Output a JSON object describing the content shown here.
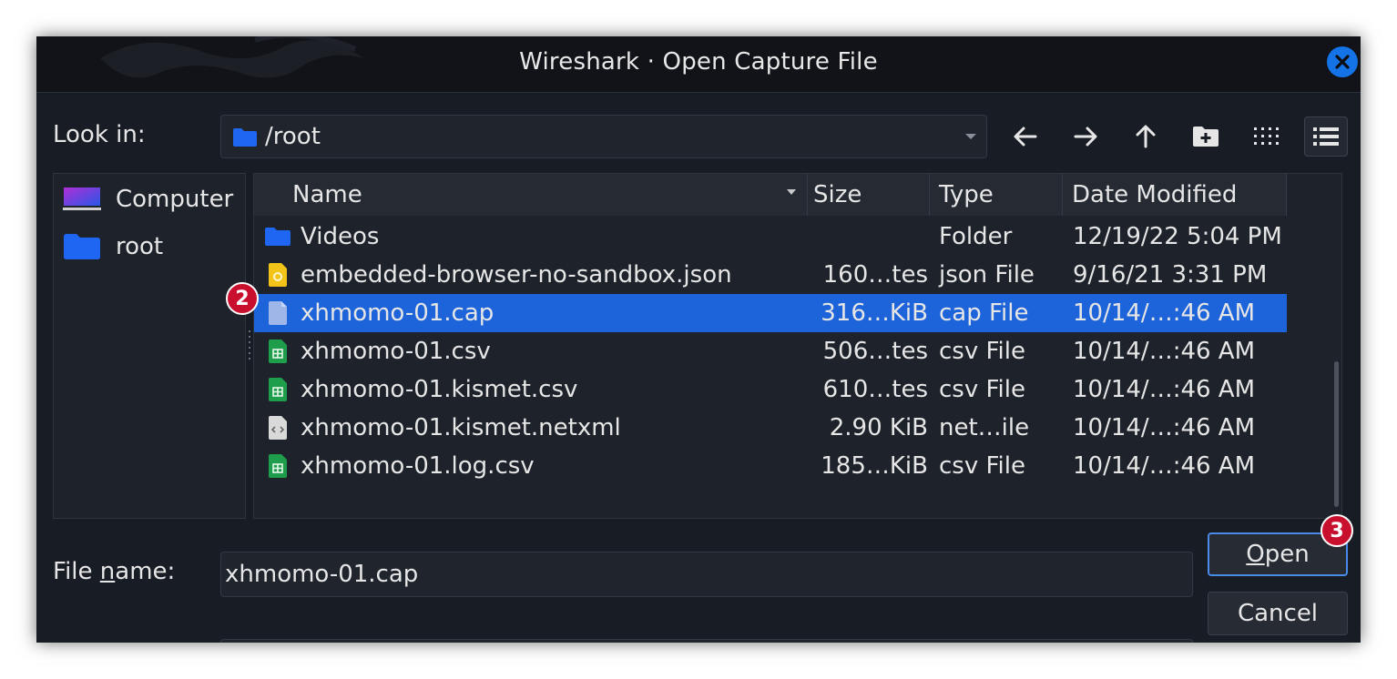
{
  "window": {
    "title": "Wireshark · Open Capture File",
    "accent_color": "#1473e6"
  },
  "toolbar": {
    "look_in_label": "Look in:",
    "path": "/root",
    "buttons": [
      "back-arrow-icon",
      "forward-arrow-icon",
      "up-arrow-icon",
      "new-folder-icon",
      "icon-view-icon",
      "detail-view-icon"
    ]
  },
  "sidebar": {
    "items": [
      {
        "label": "Computer",
        "icon": "computer-icon"
      },
      {
        "label": "root",
        "icon": "folder-icon"
      }
    ]
  },
  "file_list": {
    "columns": [
      "Name",
      "Size",
      "Type",
      "Date Modified"
    ],
    "selected_color": "#1d63d9",
    "rows": [
      {
        "name": "Videos",
        "size": "",
        "type": "Folder",
        "date": "12/19/22 5:04 PM",
        "icon": "folder-icon"
      },
      {
        "name": "embedded-browser-no-sandbox.json",
        "size": "160…tes",
        "type": "json File",
        "date": "9/16/21 3:31 PM",
        "icon": "json-file-icon"
      },
      {
        "name": "xhmomo-01.cap",
        "size": "316…KiB",
        "type": "cap File",
        "date": "10/14/…:46 AM",
        "icon": "file-icon",
        "selected": true
      },
      {
        "name": "xhmomo-01.csv",
        "size": "506…tes",
        "type": "csv File",
        "date": "10/14/…:46 AM",
        "icon": "spreadsheet-icon"
      },
      {
        "name": "xhmomo-01.kismet.csv",
        "size": "610…tes",
        "type": "csv File",
        "date": "10/14/…:46 AM",
        "icon": "spreadsheet-icon"
      },
      {
        "name": "xhmomo-01.kismet.netxml",
        "size": "2.90 KiB",
        "type": "net…ile",
        "date": "10/14/…:46 AM",
        "icon": "xml-file-icon"
      },
      {
        "name": "xhmomo-01.log.csv",
        "size": "185…KiB",
        "type": "csv File",
        "date": "10/14/…:46 AM",
        "icon": "spreadsheet-icon"
      }
    ]
  },
  "filename": {
    "label_pre": "File ",
    "label_mnemonic": "n",
    "label_post": "ame:",
    "value": "xhmomo-01.cap"
  },
  "buttons": {
    "open_mnemonic": "O",
    "open_rest": "pen",
    "cancel_label": "Cancel"
  },
  "annotations": {
    "marker_2": "2",
    "marker_3": "3",
    "marker_color": "#c8102e"
  }
}
